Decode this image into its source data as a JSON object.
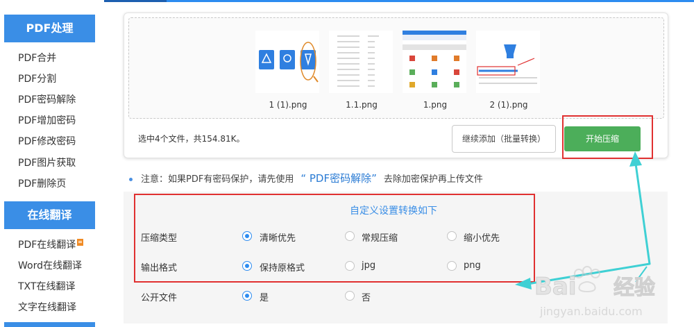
{
  "sidebar": {
    "sections": [
      {
        "header": "PDF处理",
        "items": [
          "PDF合并",
          "PDF分割",
          "PDF密码解除",
          "PDF增加密码",
          "PDF修改密码",
          "PDF图片获取",
          "PDF删除页"
        ]
      },
      {
        "header": "在线翻译",
        "items": [
          "PDF在线翻译",
          "Word在线翻译",
          "TXT在线翻译",
          "文字在线翻译"
        ]
      }
    ]
  },
  "upload": {
    "files": [
      {
        "name": "1 (1).png"
      },
      {
        "name": "1.1.png"
      },
      {
        "name": "1.png"
      },
      {
        "name": "2 (1).png"
      }
    ],
    "selected_info": "选中4个文件，共154.81K。",
    "add_button": "继续添加（批量转换）",
    "start_button": "开始压缩"
  },
  "notice": {
    "prefix": "注意：如果PDF有密码保护，请先使用",
    "link": "“ PDF密码解除”",
    "suffix": "去除加密保护再上传文件"
  },
  "settings": {
    "title": "自定义设置转换如下",
    "rows": [
      {
        "label": "压缩类型",
        "options": [
          "清晰优先",
          "常规压缩",
          "缩小优先"
        ],
        "selected": 0
      },
      {
        "label": "输出格式",
        "options": [
          "保持原格式",
          "jpg",
          "png"
        ],
        "selected": 0
      },
      {
        "label": "公开文件",
        "options": [
          "是",
          "否"
        ],
        "selected": 0
      }
    ]
  },
  "watermark": {
    "brand": "Baidu经验",
    "url": "jingyan.baidu.com"
  },
  "colors": {
    "accent_blue": "#3a8ee6",
    "start_green": "#4cae5a",
    "highlight_red": "#e03030",
    "arrow_cyan": "#3fd0d4"
  }
}
